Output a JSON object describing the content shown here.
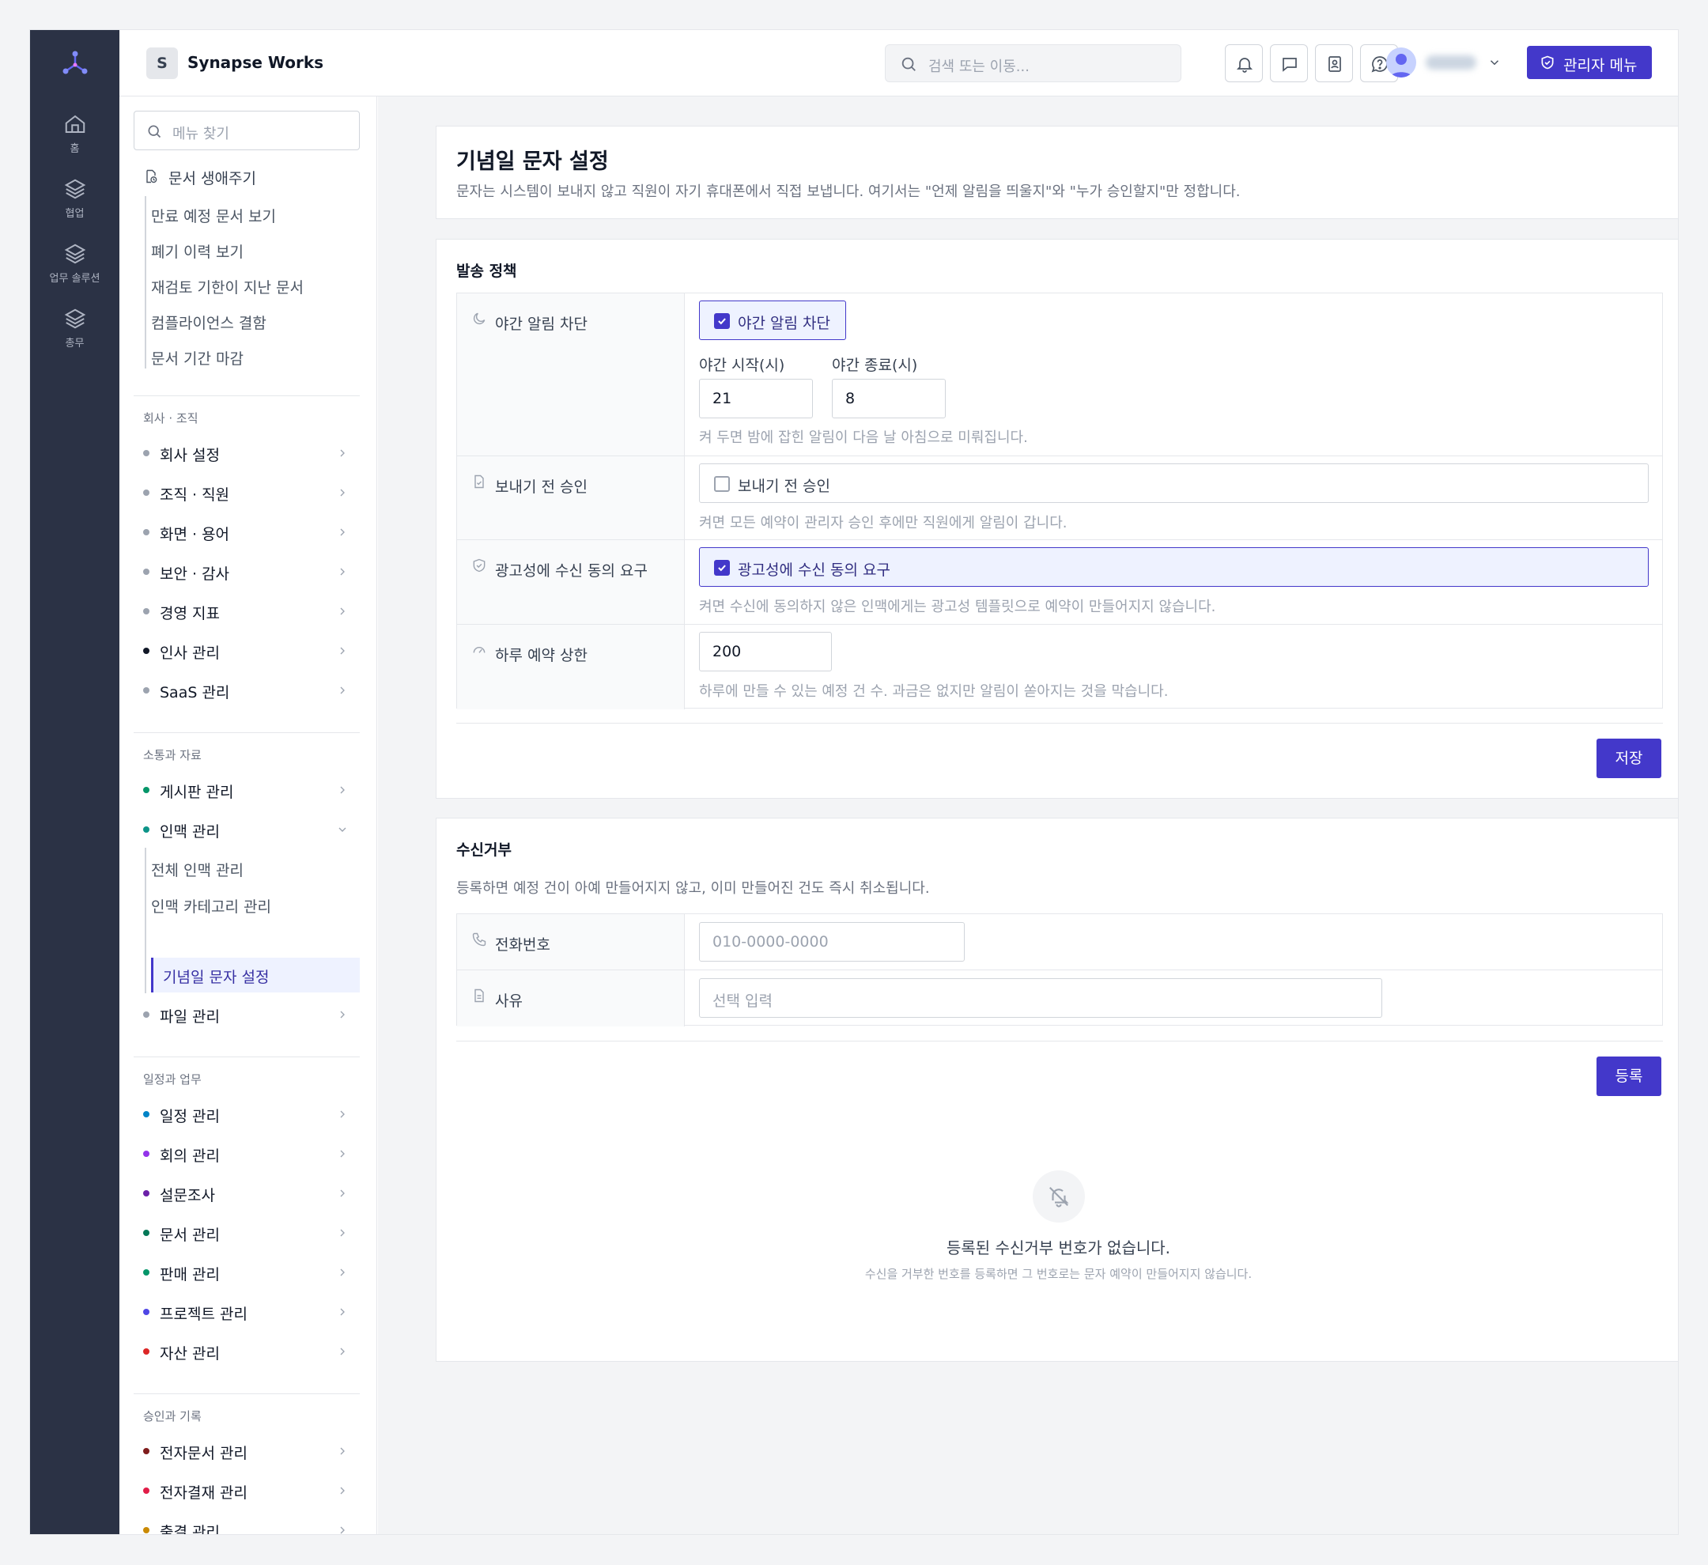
{
  "rail": {
    "items": [
      {
        "label": "홈",
        "icon": "home-icon"
      },
      {
        "label": "협업",
        "icon": "layers-icon"
      },
      {
        "label": "업무 솔루션",
        "icon": "layers-icon"
      },
      {
        "label": "총무",
        "icon": "layers-icon"
      }
    ]
  },
  "topbar": {
    "org_initial": "S",
    "org_name": "Synapse Works",
    "search_placeholder": "검색 또는 이동...",
    "admin_label": "관리자 메뉴"
  },
  "sidebar": {
    "search_placeholder": "메뉴 찾기",
    "doc_group": {
      "label": "문서 생애주기",
      "subs": [
        "만료 예정 문서 보기",
        "폐기 이력 보기",
        "재검토 기한이 지난 문서",
        "컴플라이언스 결함",
        "문서 기간 마감"
      ]
    },
    "sections": [
      {
        "title": "회사 · 조직",
        "items": [
          {
            "label": "회사 설정",
            "color": "#9ca3af"
          },
          {
            "label": "조직 · 직원",
            "color": "#9ca3af"
          },
          {
            "label": "화면 · 용어",
            "color": "#9ca3af"
          },
          {
            "label": "보안 · 감사",
            "color": "#9ca3af"
          },
          {
            "label": "경영 지표",
            "color": "#9ca3af"
          },
          {
            "label": "인사 관리",
            "color": "#111827"
          },
          {
            "label": "SaaS 관리",
            "color": "#9ca3af"
          }
        ]
      },
      {
        "title": "소통과 자료",
        "items": [
          {
            "label": "게시판 관리",
            "color": "#059669"
          },
          {
            "label": "인맥 관리",
            "color": "#0d9488"
          },
          {
            "label": "파일 관리",
            "color": "#9ca3af"
          }
        ],
        "contacts_subs": [
          "전체 인맥 관리",
          "인맥 카테고리 관리",
          "기념일 문자 설정"
        ]
      },
      {
        "title": "일정과 업무",
        "items": [
          {
            "label": "일정 관리",
            "color": "#0284c7"
          },
          {
            "label": "회의 관리",
            "color": "#9333ea"
          },
          {
            "label": "설문조사",
            "color": "#6b21a8"
          },
          {
            "label": "문서 관리",
            "color": "#047857"
          },
          {
            "label": "판매 관리",
            "color": "#059669"
          },
          {
            "label": "프로젝트 관리",
            "color": "#4f46e5"
          },
          {
            "label": "자산 관리",
            "color": "#dc2626"
          }
        ]
      },
      {
        "title": "승인과 기록",
        "items": [
          {
            "label": "전자문서 관리",
            "color": "#7f1d1d"
          },
          {
            "label": "전자결재 관리",
            "color": "#e11d48"
          },
          {
            "label": "출결 관리",
            "color": "#ca8a04"
          }
        ]
      }
    ]
  },
  "page": {
    "title": "기념일 문자 설정",
    "description": "문자는 시스템이 보내지 않고 직원이 자기 휴대폰에서 직접 보냅니다. 여기서는 \"언제 알림을 띄울지\"와 \"누가 승인할지\"만 정합니다."
  },
  "policy": {
    "title": "발송 정책",
    "night": {
      "label": "야간 알림 차단",
      "checkbox_label": "야간 알림 차단",
      "checked": true,
      "start_label": "야간 시작(시)",
      "start_value": "21",
      "end_label": "야간 종료(시)",
      "end_value": "8",
      "hint": "켜 두면 밤에 잡힌 알림이 다음 날 아침으로 미뤄집니다."
    },
    "approval": {
      "label": "보내기 전 승인",
      "checkbox_label": "보내기 전 승인",
      "checked": false,
      "hint": "켜면 모든 예약이 관리자 승인 후에만 직원에게 알림이 갑니다."
    },
    "consent": {
      "label": "광고성에 수신 동의 요구",
      "checkbox_label": "광고성에 수신 동의 요구",
      "checked": true,
      "hint": "켜면 수신에 동의하지 않은 인맥에게는 광고성 템플릿으로 예약이 만들어지지 않습니다."
    },
    "limit": {
      "label": "하루 예약 상한",
      "value": "200",
      "hint": "하루에 만들 수 있는 예정 건 수. 과금은 없지만 알림이 쏟아지는 것을 막습니다."
    },
    "save_label": "저장"
  },
  "optout": {
    "title": "수신거부",
    "description": "등록하면 예정 건이 아예 만들어지지 않고, 이미 만들어진 건도 즉시 취소됩니다.",
    "phone_label": "전화번호",
    "phone_placeholder": "010-0000-0000",
    "reason_label": "사유",
    "reason_placeholder": "선택 입력",
    "register_label": "등록",
    "empty_title": "등록된 수신거부 번호가 없습니다.",
    "empty_sub": "수신을 거부한 번호를 등록하면 그 번호로는 문자 예약이 만들어지지 않습니다."
  }
}
